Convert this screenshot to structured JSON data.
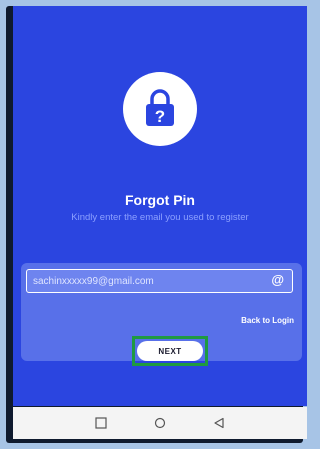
{
  "screen": {
    "title": "Forgot Pin",
    "subtitle": "Kindly enter the email you used to register",
    "logo_icon": "padlock-question-icon"
  },
  "form": {
    "email_value": "sachinxxxxx99@gmail.com",
    "email_icon": "at-icon",
    "at_glyph": "@",
    "back_link": "Back to Login",
    "next_label": "NEXT"
  },
  "nav_bar": {
    "icons": [
      "square-recents-icon",
      "circle-home-icon",
      "triangle-back-icon"
    ]
  },
  "colors": {
    "screen_bg": "#2b45e0",
    "card_bg": "#5870e9",
    "highlight": "#1f9a41"
  }
}
